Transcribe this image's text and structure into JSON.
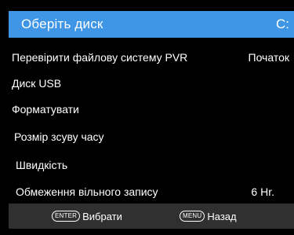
{
  "header": {
    "title": "Оберіть диск",
    "value": "C:"
  },
  "menu": {
    "items": [
      {
        "label": "Перевірити файлову систему PVR",
        "value": "Початок"
      },
      {
        "label": "Диск USB",
        "value": ""
      },
      {
        "label": "Форматувати",
        "value": ""
      },
      {
        "label": "Розмір зсуву часу",
        "value": ""
      },
      {
        "label": "Швидкість",
        "value": ""
      },
      {
        "label": "Обмеження вільного запису",
        "value": "6 Hr."
      }
    ]
  },
  "footer": {
    "select_key": "ENTER",
    "select_label": "Вибрати",
    "back_key": "MENU",
    "back_label": "Назад"
  },
  "colors": {
    "header_bg": "#3f95e6",
    "footer_bg": "#303030",
    "background": "#000000",
    "text": "#ffffff"
  }
}
